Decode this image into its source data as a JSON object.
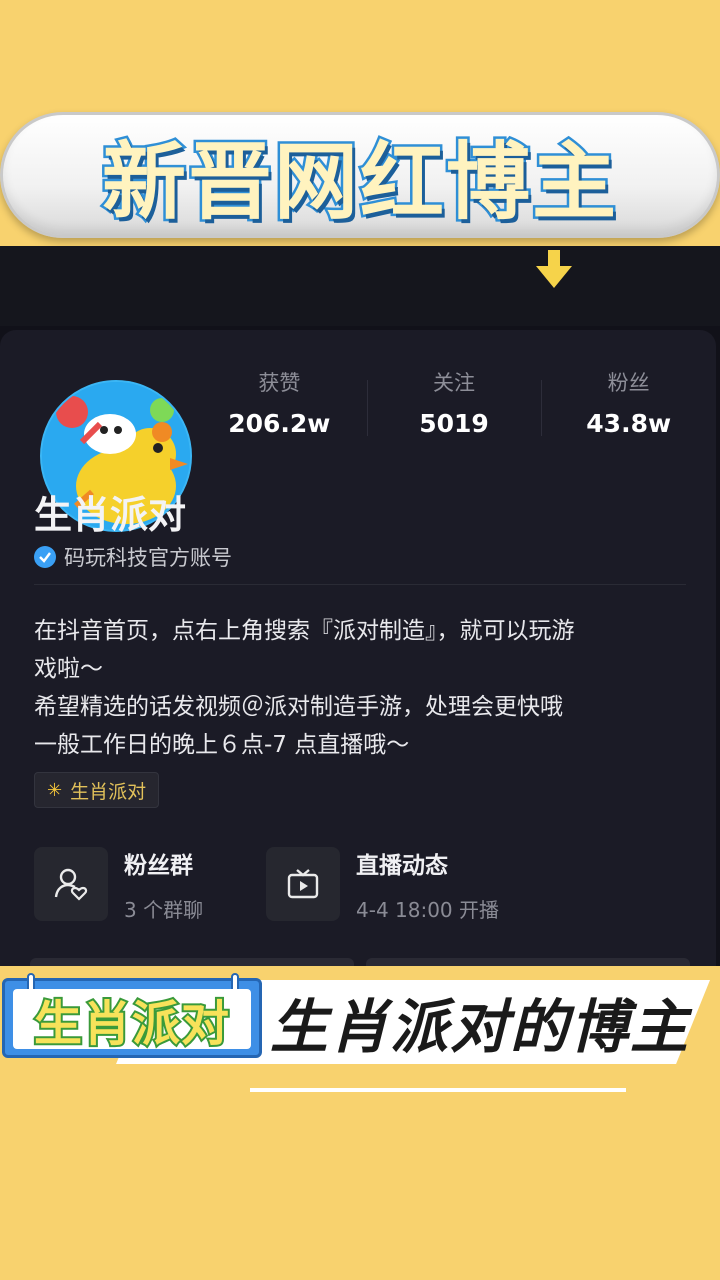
{
  "top_banner": {
    "title": "新晋网红博主"
  },
  "profile": {
    "stats": [
      {
        "label": "获赞",
        "value": "206.2w"
      },
      {
        "label": "关注",
        "value": "5019"
      },
      {
        "label": "粉丝",
        "value": "43.8w"
      }
    ],
    "name": "生肖派对",
    "verified_label": "码玩科技官方账号",
    "bio_lines": [
      "在抖音首页，点右上角搜索『派对制造』，就可以玩游",
      "戏啦～",
      "希望精选的话发视频＠派对制造手游，处理会更快哦",
      "一般工作日的晚上６点-7 点直播哦～"
    ],
    "tag": {
      "icon": "sparkle-icon",
      "label": "生肖派对"
    },
    "features": [
      {
        "icon": "fan-group-icon",
        "title": "粉丝群",
        "subtitle": "3 个群聊"
      },
      {
        "icon": "live-tv-icon",
        "title": "直播动态",
        "subtitle": "4-4 18:00 开播"
      }
    ]
  },
  "bottom_banner": {
    "board_label": "生肖派对",
    "title": "生肖派对的博主"
  },
  "colors": {
    "background": "#f8d26e",
    "screen_bg": "#111119",
    "card_bg": "#1b1b26",
    "accent_blue": "#3aa0f5",
    "tag_gold": "#e2c15a"
  }
}
